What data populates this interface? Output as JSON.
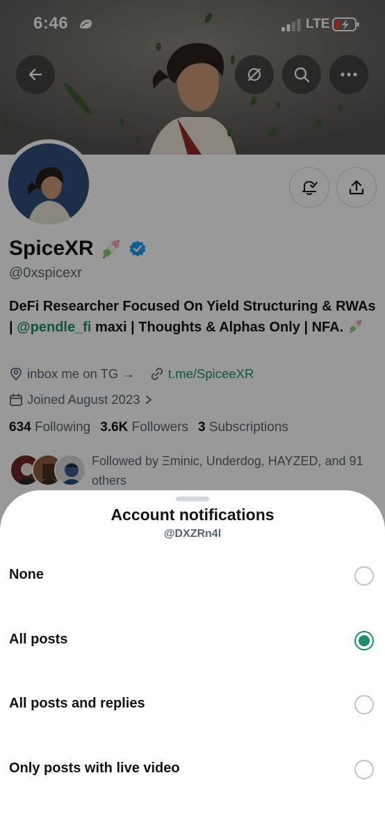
{
  "status_bar": {
    "time": "6:46",
    "network": "LTE"
  },
  "profile": {
    "name": "SpiceXR",
    "handle": "@0xspicexr",
    "bio_part1": "DeFi Researcher Focused On Yield Structuring & RWAs | ",
    "bio_mention": "@pendle_fi",
    "bio_part2": " maxi | Thoughts & Alphas Only | NFA.",
    "location": "inbox me on TG →",
    "website": "t.me/SpiceeXR",
    "joined": "Joined August 2023",
    "following_count": "634",
    "following_label": "Following",
    "followers_count": "3.6K",
    "followers_label": "Followers",
    "subscriptions_count": "3",
    "subscriptions_label": "Subscriptions",
    "followed_by": "Followed by Ξminic, Underdog, HAYZED, and 91 others"
  },
  "sheet": {
    "title": "Account notifications",
    "subtitle": "@DXZRn4l",
    "options": [
      {
        "label": "None",
        "selected": false
      },
      {
        "label": "All posts",
        "selected": true
      },
      {
        "label": "All posts and replies",
        "selected": false
      },
      {
        "label": "Only posts with live video",
        "selected": false
      }
    ]
  },
  "colors": {
    "accent": "#1a8f63",
    "verified": "#1d9bf0",
    "secondary_text": "#536471"
  },
  "icons": [
    "back-arrow-icon",
    "hide-icon",
    "search-icon",
    "more-icon",
    "notification-bell-icon",
    "share-icon",
    "location-icon",
    "link-icon",
    "calendar-icon",
    "verified-badge-icon"
  ]
}
